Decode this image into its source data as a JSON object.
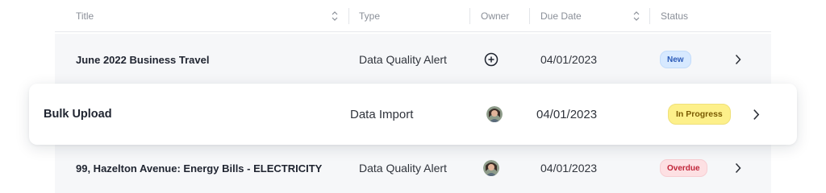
{
  "columns": {
    "title": "Title",
    "type": "Type",
    "owner": "Owner",
    "due_date": "Due Date",
    "status": "Status"
  },
  "rows": [
    {
      "title": "June 2022 Business Travel",
      "type": "Data Quality Alert",
      "owner": "add-owner-icon",
      "due_date": "04/01/2023",
      "status": "New",
      "status_color": "#d7e9ff"
    },
    {
      "title": "Bulk Upload",
      "type": "Data Import",
      "owner": "avatar",
      "due_date": "04/01/2023",
      "status": "In Progress",
      "status_color": "#fdf08a"
    },
    {
      "title": "99, Hazelton Avenue: Energy Bills - ELECTRICITY",
      "type": "Data Quality Alert",
      "owner": "avatar",
      "due_date": "04/01/2023",
      "status": "Overdue",
      "status_color": "#fde0e3"
    }
  ]
}
